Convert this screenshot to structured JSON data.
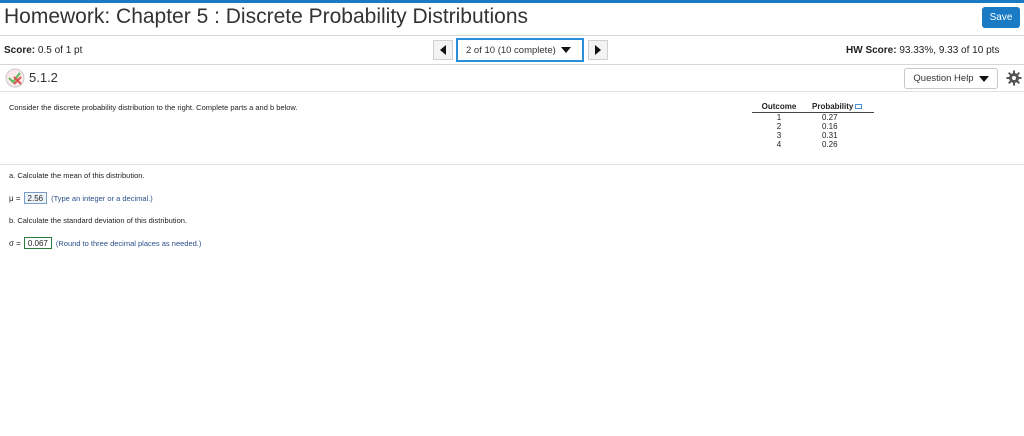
{
  "header": {
    "title": "Homework: Chapter 5 : Discrete Probability Distributions",
    "save_label": "Save"
  },
  "score": {
    "label": "Score:",
    "value": "0.5 of 1 pt"
  },
  "navigator": {
    "current": "2 of 10 (10 complete)"
  },
  "hw_score": {
    "label": "HW Score:",
    "value": "93.33%, 9.33 of 10 pts"
  },
  "question": {
    "number": "5.1.2",
    "help_label": "Question Help",
    "prompt": "Consider the discrete probability distribution to the right. Complete parts a and b below."
  },
  "distribution_table": {
    "headers": [
      "Outcome",
      "Probability"
    ],
    "rows": [
      [
        "1",
        "0.27"
      ],
      [
        "2",
        "0.16"
      ],
      [
        "3",
        "0.31"
      ],
      [
        "4",
        "0.26"
      ]
    ]
  },
  "part_a": {
    "question": "a. Calculate the mean of this distribution.",
    "symbol": "μ =",
    "answer": "2.56",
    "hint": "(Type an integer or a decimal.)"
  },
  "part_b": {
    "question": "b. Calculate the standard deviation of this distribution.",
    "symbol": "σ =",
    "answer": "0.067",
    "hint": "(Round to three decimal places as needed.)"
  },
  "colors": {
    "accent": "#1a7bc4",
    "status_icon_partial": "#d9534f",
    "status_icon_check": "#5cb85c"
  }
}
